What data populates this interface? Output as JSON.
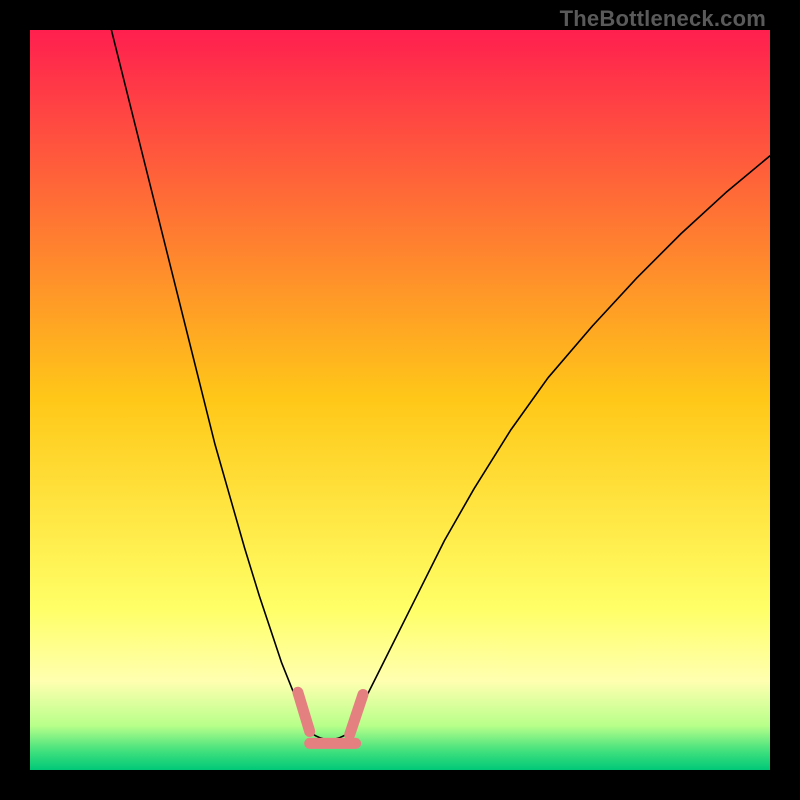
{
  "watermark": "TheBottleneck.com",
  "chart_data": {
    "type": "line",
    "title": "",
    "xlabel": "",
    "ylabel": "",
    "xlim": [
      0,
      100
    ],
    "ylim": [
      0,
      100
    ],
    "background_gradient": {
      "stops": [
        {
          "offset": 0.0,
          "color": "#ff1f4f"
        },
        {
          "offset": 0.5,
          "color": "#ffc818"
        },
        {
          "offset": 0.78,
          "color": "#ffff66"
        },
        {
          "offset": 0.88,
          "color": "#ffffb0"
        },
        {
          "offset": 0.94,
          "color": "#b8ff8a"
        },
        {
          "offset": 0.975,
          "color": "#3fe07d"
        },
        {
          "offset": 1.0,
          "color": "#00c878"
        }
      ]
    },
    "series": [
      {
        "name": "left-branch",
        "color": "#000000",
        "width": 1.6,
        "x": [
          11,
          13,
          15,
          17,
          19,
          21,
          23,
          25,
          27,
          29,
          31,
          33,
          34,
          35,
          36,
          37,
          38
        ],
        "y": [
          100,
          92,
          84,
          76,
          68,
          60,
          52,
          44,
          37,
          30,
          23.5,
          17.5,
          14.5,
          12,
          9.5,
          7.5,
          5.0
        ]
      },
      {
        "name": "right-branch",
        "color": "#000000",
        "width": 1.6,
        "x": [
          43,
          45,
          48,
          52,
          56,
          60,
          65,
          70,
          76,
          82,
          88,
          94,
          100
        ],
        "y": [
          5.0,
          9,
          15,
          23,
          31,
          38,
          46,
          53,
          60,
          66.5,
          72.5,
          78,
          83
        ]
      },
      {
        "name": "highlight-band",
        "color": "#e58080",
        "type": "thick-segments",
        "segments": [
          {
            "x1": 36.2,
            "y1": 10.5,
            "x2": 37.8,
            "y2": 5.2,
            "w": 11
          },
          {
            "x1": 37.8,
            "y1": 3.6,
            "x2": 44.0,
            "y2": 3.6,
            "w": 11
          },
          {
            "x1": 43.2,
            "y1": 4.8,
            "x2": 45.0,
            "y2": 10.2,
            "w": 11
          }
        ]
      }
    ],
    "valley": {
      "x_min": 38,
      "x_max": 43,
      "y": 3.2
    }
  }
}
